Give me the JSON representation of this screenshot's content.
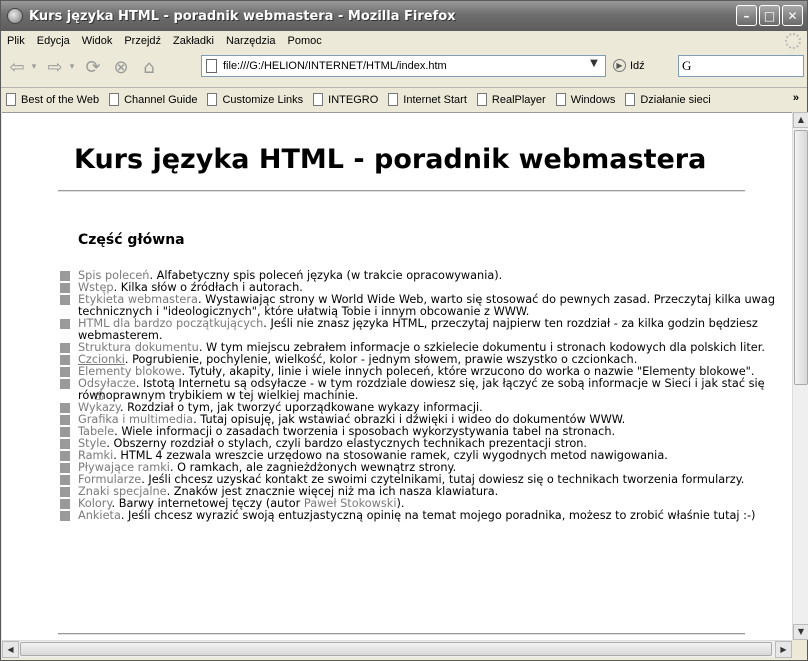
{
  "window": {
    "title": "Kurs języka HTML - poradnik webmastera - Mozilla Firefox"
  },
  "menu": {
    "items": [
      "Plik",
      "Edycja",
      "Widok",
      "Przejdź",
      "Zakładki",
      "Narzędzia",
      "Pomoc"
    ]
  },
  "nav": {
    "url": "file:///G:/HELION/INTERNET/HTML/index.htm",
    "go_label": "Idź",
    "search_value": "G"
  },
  "bookmarks": {
    "items": [
      "Best of the Web",
      "Channel Guide",
      "Customize Links",
      "INTEGRO",
      "Internet Start",
      "RealPlayer",
      "Windows",
      "Działanie sieci"
    ],
    "overflow": "»"
  },
  "page": {
    "title": "Kurs języka HTML - poradnik webmastera",
    "section_title": "Część główna",
    "items": [
      {
        "link": "Spis poleceń",
        "text": ". Alfabetyczny spis poleceń języka (w trakcie opracowywania)."
      },
      {
        "link": "Wstęp",
        "text": ". Kilka słów o źródłach i autorach."
      },
      {
        "link": "Etykieta webmastera",
        "text": ". Wystawiając strony w World Wide Web, warto się stosować do pewnych zasad. Przeczytaj kilka uwag technicznych i \"ideologicznych\", które ułatwią Tobie i innym obcowanie z WWW."
      },
      {
        "link": "HTML dla bardzo początkujących",
        "text": ". Jeśli nie znasz języka HTML, przeczytaj najpierw ten rozdział - za kilka godzin będziesz webmasterem."
      },
      {
        "link": "Struktura dokumentu",
        "text": ". W tym miejscu zebrałem informacje o szkielecie dokumentu i stronach kodowych dla polskich liter."
      },
      {
        "link": "Czcionki",
        "text": ". Pogrubienie, pochylenie, wielkość, kolor - jednym słowem, prawie wszystko o czcionkach."
      },
      {
        "link": "Elementy blokowe",
        "text": ". Tytuły, akapity, linie i wiele innych poleceń, które wrzucono do worka o nazwie \"Elementy blokowe\"."
      },
      {
        "link": "Odsyłacze",
        "text": ". Istotą Internetu są odsyłacze - w tym rozdziale dowiesz się, jak łączyć ze sobą informacje w Sieci i jak stać się równoprawnym trybikiem w tej wielkiej machinie."
      },
      {
        "link": "Wykazy",
        "text": ". Rozdział o tym, jak tworzyć uporządkowane wykazy informacji."
      },
      {
        "link": "Grafika i multimedia",
        "text": ". Tutaj opisuję, jak wstawiać obrazki i dźwięki i wideo do dokumentów WWW."
      },
      {
        "link": "Tabele",
        "text": ". Wiele informacji o zasadach tworzenia i sposobach wykorzystywania tabel na stronach."
      },
      {
        "link": "Style",
        "text": ". Obszerny rozdział o stylach, czyli bardzo elastycznych technikach prezentacji stron."
      },
      {
        "link": "Ramki",
        "text": ". HTML 4 zezwala wreszcie urzędowo na stosowanie ramek, czyli wygodnych metod nawigowania."
      },
      {
        "link": "Pływające ramki",
        "text": ". O ramkach, ale zagnieżdżonych wewnątrz strony."
      },
      {
        "link": "Formularze",
        "text": ". Jeśli chcesz uzyskać kontakt ze swoimi czytelnikami, tutaj dowiesz się o technikach tworzenia formularzy."
      },
      {
        "link": "Znaki specjalne",
        "text": ". Znaków jest znacznie więcej niż ma ich nasza klawiatura."
      },
      {
        "link": "Kolory",
        "text": ". Barwy internetowej tęczy (autor ",
        "link2": "Paweł Stokowski",
        "text2": ")."
      },
      {
        "link": "Ankieta",
        "text": ". Jeśli chcesz wyrazić swoją entuzjastyczną opinię na temat mojego poradnika, możesz to zrobić właśnie tutaj :-)"
      }
    ]
  },
  "icons": {
    "back": "back-arrow-icon",
    "forward": "forward-arrow-icon",
    "reload": "reload-icon",
    "stop": "stop-icon",
    "home": "home-icon"
  },
  "colors": {
    "link": "#7a7a7a",
    "bullet": "#9a9a9a",
    "titlebar": "#6e6e6e"
  }
}
